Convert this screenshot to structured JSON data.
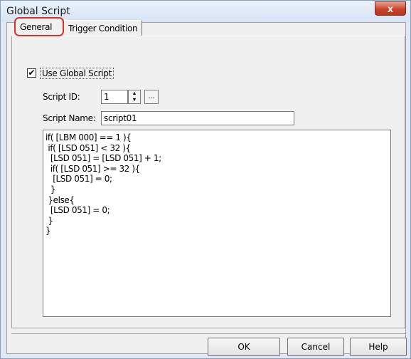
{
  "window": {
    "title": "Global Script",
    "close_glyph": "x"
  },
  "tabs": [
    {
      "label": "General"
    },
    {
      "label": "Trigger Condition"
    }
  ],
  "use_global": {
    "label": "Use Global Script",
    "checked_glyph": "✔"
  },
  "script_id": {
    "label": "Script ID:",
    "value": "1",
    "browse_label": "..."
  },
  "script_name": {
    "label": "Script Name:",
    "value": "script01"
  },
  "script_lines": [
    "if( [LBM 000] == 1 ){",
    " if( [LSD 051] < 32 ){",
    "  [LSD 051] = [LSD 051] + 1;",
    "  if( [LSD 051] >= 32 ){",
    "   [LSD 051] = 0;",
    "  }",
    " }else{",
    "  [LSD 051] = 0;",
    " }",
    "}"
  ],
  "buttons": {
    "ok": "OK",
    "cancel": "Cancel",
    "help": "Help"
  }
}
